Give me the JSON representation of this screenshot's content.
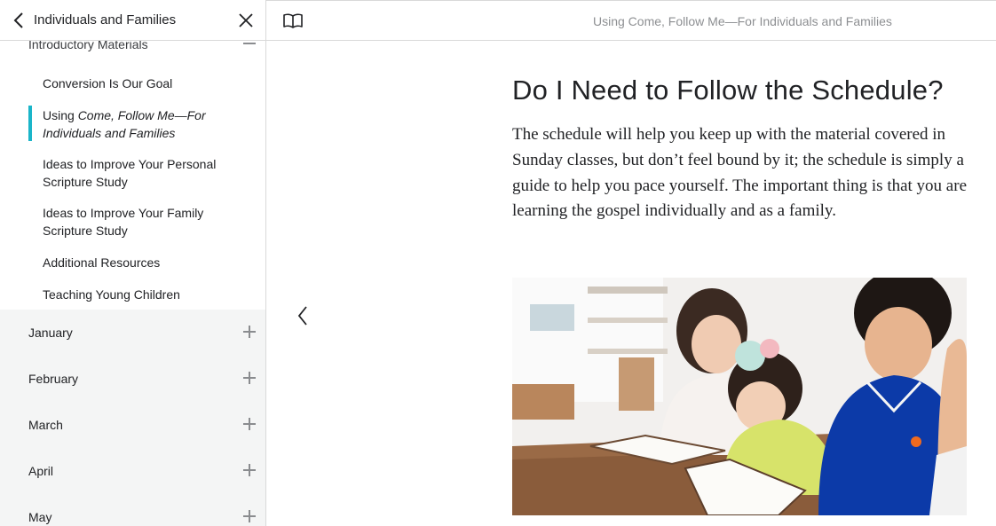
{
  "sidebar": {
    "title": "Individuals and Families",
    "section": "Introductory Materials",
    "items": [
      {
        "label": "Conversion Is Our Goal"
      },
      {
        "label_pre": "Using ",
        "label_italic": "Come, Follow Me—For Individuals and Families",
        "active": true
      },
      {
        "label": "Ideas to Improve Your Personal Scripture Study"
      },
      {
        "label": "Ideas to Improve Your Family Scripture Study"
      },
      {
        "label": "Additional Resources"
      },
      {
        "label": "Teaching Young Children"
      }
    ],
    "months": [
      "January",
      "February",
      "March",
      "April",
      "May"
    ]
  },
  "header": {
    "doc_title": "Using Come, Follow Me—For Individuals and Families"
  },
  "main": {
    "heading": "Do I Need to Follow the Schedule?",
    "body": "The schedule will help you keep up with the material covered in Sunday classes, but don’t feel bound by it; the schedule is simply a guide to help you pace yourself. The important thing is that you are learning the gospel individually and as a family."
  },
  "colors": {
    "accent": "#1ab5c9",
    "sidebar_months_bg": "#f4f5f5",
    "muted_text": "#8d8f92"
  },
  "icons": {
    "back": "chevron-left-icon",
    "close": "close-icon",
    "book": "open-book-icon",
    "prev": "chevron-left-icon",
    "collapse": "minus-icon",
    "expand": "plus-icon"
  }
}
